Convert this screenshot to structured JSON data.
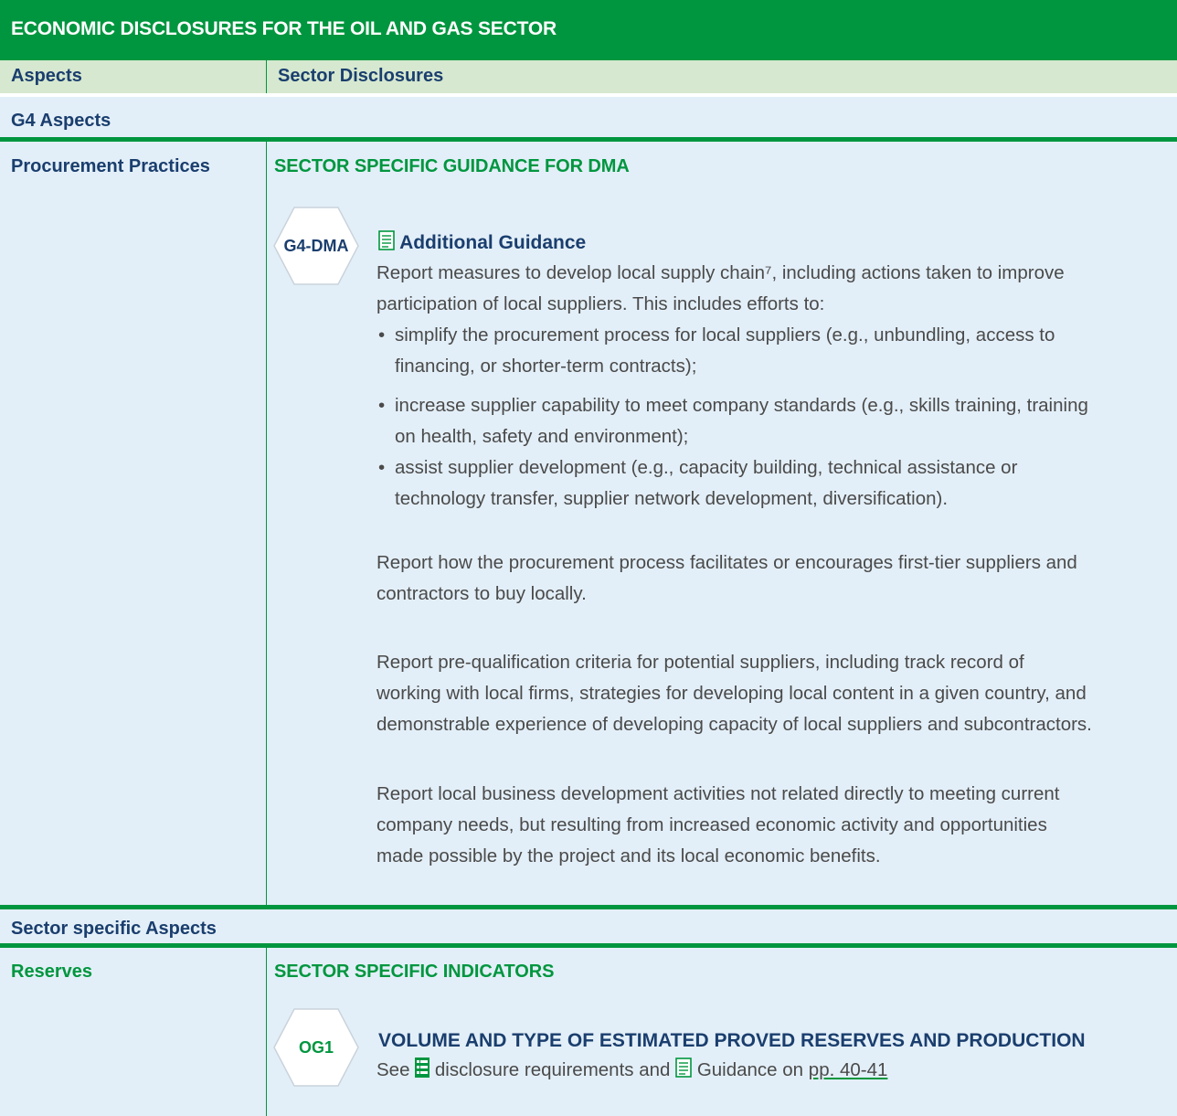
{
  "table_title": "ECONOMIC DISCLOSURES FOR THE OIL AND GAS SECTOR",
  "header": {
    "col1": "Aspects",
    "col2": "Sector Disclosures"
  },
  "g4": {
    "band_label": "G4 Aspects",
    "aspect": "Procurement Practices",
    "section_heading": "SECTOR SPECIFIC GUIDANCE FOR DMA",
    "badge": "G4-DMA",
    "guidance_title": "Additional Guidance",
    "p1_line1": "Report measures to develop local supply chain⁷, including actions taken to improve",
    "p1_line2": "participation of local suppliers. This includes efforts to:",
    "bullet_char": "•",
    "b1_line1": "simplify the procurement process for local suppliers (e.g., unbundling, access to",
    "b1_line2": "financing, or shorter-term contracts);",
    "b2_line1": "increase supplier capability to meet company standards (e.g., skills training, training",
    "b2_line2": "on health, safety and environment);",
    "b3_line1": "assist supplier development (e.g., capacity building, technical assistance or",
    "b3_line2": "technology transfer, supplier network development, diversification).",
    "p2_line1": "Report how the procurement process facilitates or encourages first-tier suppliers and",
    "p2_line2": "contractors to buy locally.",
    "p3_line1": "Report pre-qualification criteria for potential suppliers, including track record of",
    "p3_line2": "working with local firms, strategies for developing local content in a given country, and",
    "p3_line3": "demonstrable experience of developing capacity of local suppliers and subcontractors.",
    "p4_line1": "Report local business development activities not related directly to meeting current",
    "p4_line2": "company needs, but resulting from increased economic activity and opportunities",
    "p4_line3": "made possible by the project and its local economic benefits."
  },
  "sector": {
    "band_label": "Sector specific Aspects",
    "aspect": "Reserves",
    "section_heading": "SECTOR SPECIFIC INDICATORS",
    "badge": "OG1",
    "indicator_title": "VOLUME AND TYPE OF ESTIMATED PROVED RESERVES AND PRODUCTION",
    "see_text": "See",
    "disclosure_text": "disclosure requirements and",
    "guidance_text": "Guidance on",
    "pages_link": "pp. 40-41"
  },
  "colors": {
    "green": "#00963f",
    "navy": "#1a3e6e",
    "light_blue": "#e3eff8",
    "header_green": "#d6e8cf"
  },
  "icons": {
    "guidance": "document-icon",
    "disclosure": "list-icon",
    "badge_shape": "hexagon-icon"
  }
}
